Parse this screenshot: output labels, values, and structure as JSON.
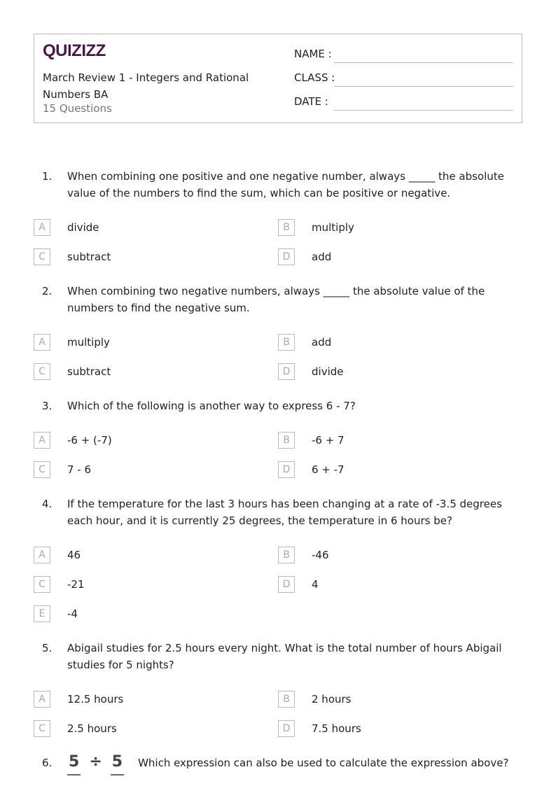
{
  "header": {
    "logo": "QUIZIZZ",
    "title": "March Review 1 - Integers and Rational Numbers BA",
    "count": "15 Questions",
    "name_label": "NAME :",
    "class_label": "CLASS :",
    "date_label": "DATE  :"
  },
  "questions": [
    {
      "num": "1.",
      "text": "When combining one positive and one negative number, always _____ the absolute value of the numbers to find the sum, which can be positive or negative.",
      "options": [
        {
          "letter": "A",
          "text": "divide"
        },
        {
          "letter": "B",
          "text": "multiply"
        },
        {
          "letter": "C",
          "text": "subtract"
        },
        {
          "letter": "D",
          "text": "add"
        }
      ]
    },
    {
      "num": "2.",
      "text": "When combining two negative numbers, always _____ the absolute value of the numbers to find the negative sum.",
      "options": [
        {
          "letter": "A",
          "text": "multiply"
        },
        {
          "letter": "B",
          "text": "add"
        },
        {
          "letter": "C",
          "text": "subtract"
        },
        {
          "letter": "D",
          "text": "divide"
        }
      ]
    },
    {
      "num": "3.",
      "text": "Which of the following is another way to express 6 - 7?",
      "options": [
        {
          "letter": "A",
          "text": "-6 + (-7)"
        },
        {
          "letter": "B",
          "text": "-6 + 7"
        },
        {
          "letter": "C",
          "text": "7 - 6"
        },
        {
          "letter": "D",
          "text": "6 + -7"
        }
      ]
    },
    {
      "num": "4.",
      "text": "If the temperature for the last 3 hours has been changing at a rate of -3.5 degrees each hour, and it is currently 25 degrees, the temperature in 6 hours be?",
      "options": [
        {
          "letter": "A",
          "text": "46"
        },
        {
          "letter": "B",
          "text": "-46"
        },
        {
          "letter": "C",
          "text": "-21"
        },
        {
          "letter": "D",
          "text": "4"
        },
        {
          "letter": "E",
          "text": "-4"
        }
      ]
    },
    {
      "num": "5.",
      "text": "Abigail studies for 2.5 hours every night. What is the total number of hours Abigail studies for 5 nights?",
      "options": [
        {
          "letter": "A",
          "text": "12.5 hours"
        },
        {
          "letter": "B",
          "text": "2 hours"
        },
        {
          "letter": "C",
          "text": "2.5 hours"
        },
        {
          "letter": "D",
          "text": "7.5 hours"
        }
      ]
    },
    {
      "num": "6.",
      "text": "Which expression can also be used to calculate the expression above?",
      "image": {
        "left": "5",
        "op": "÷",
        "right": "5"
      },
      "options": []
    }
  ]
}
